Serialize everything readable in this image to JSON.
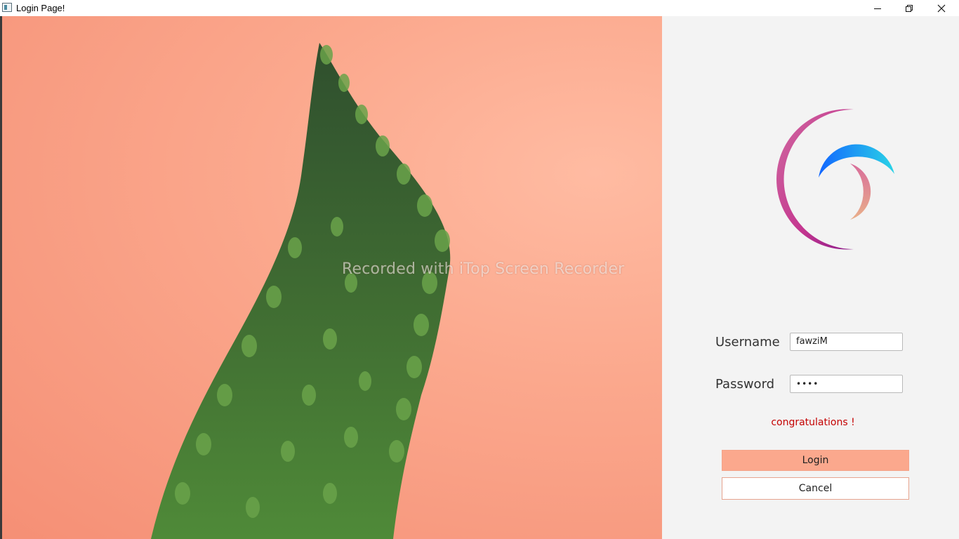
{
  "window": {
    "title": "Login Page!",
    "minimize_icon": "minimize-icon",
    "maximize_icon": "restore-icon",
    "close_icon": "close-icon"
  },
  "photo": {
    "watermark": "Recorded with iTop Screen Recorder"
  },
  "form": {
    "username_label": "Username",
    "username_value": "fawziM",
    "password_label": "Password",
    "password_value": "••••",
    "message": "congratulations !",
    "login_label": "Login",
    "cancel_label": "Cancel"
  },
  "colors": {
    "accent": "#fba88d",
    "message": "#c40000",
    "panel_bg": "#f3f3f3"
  }
}
